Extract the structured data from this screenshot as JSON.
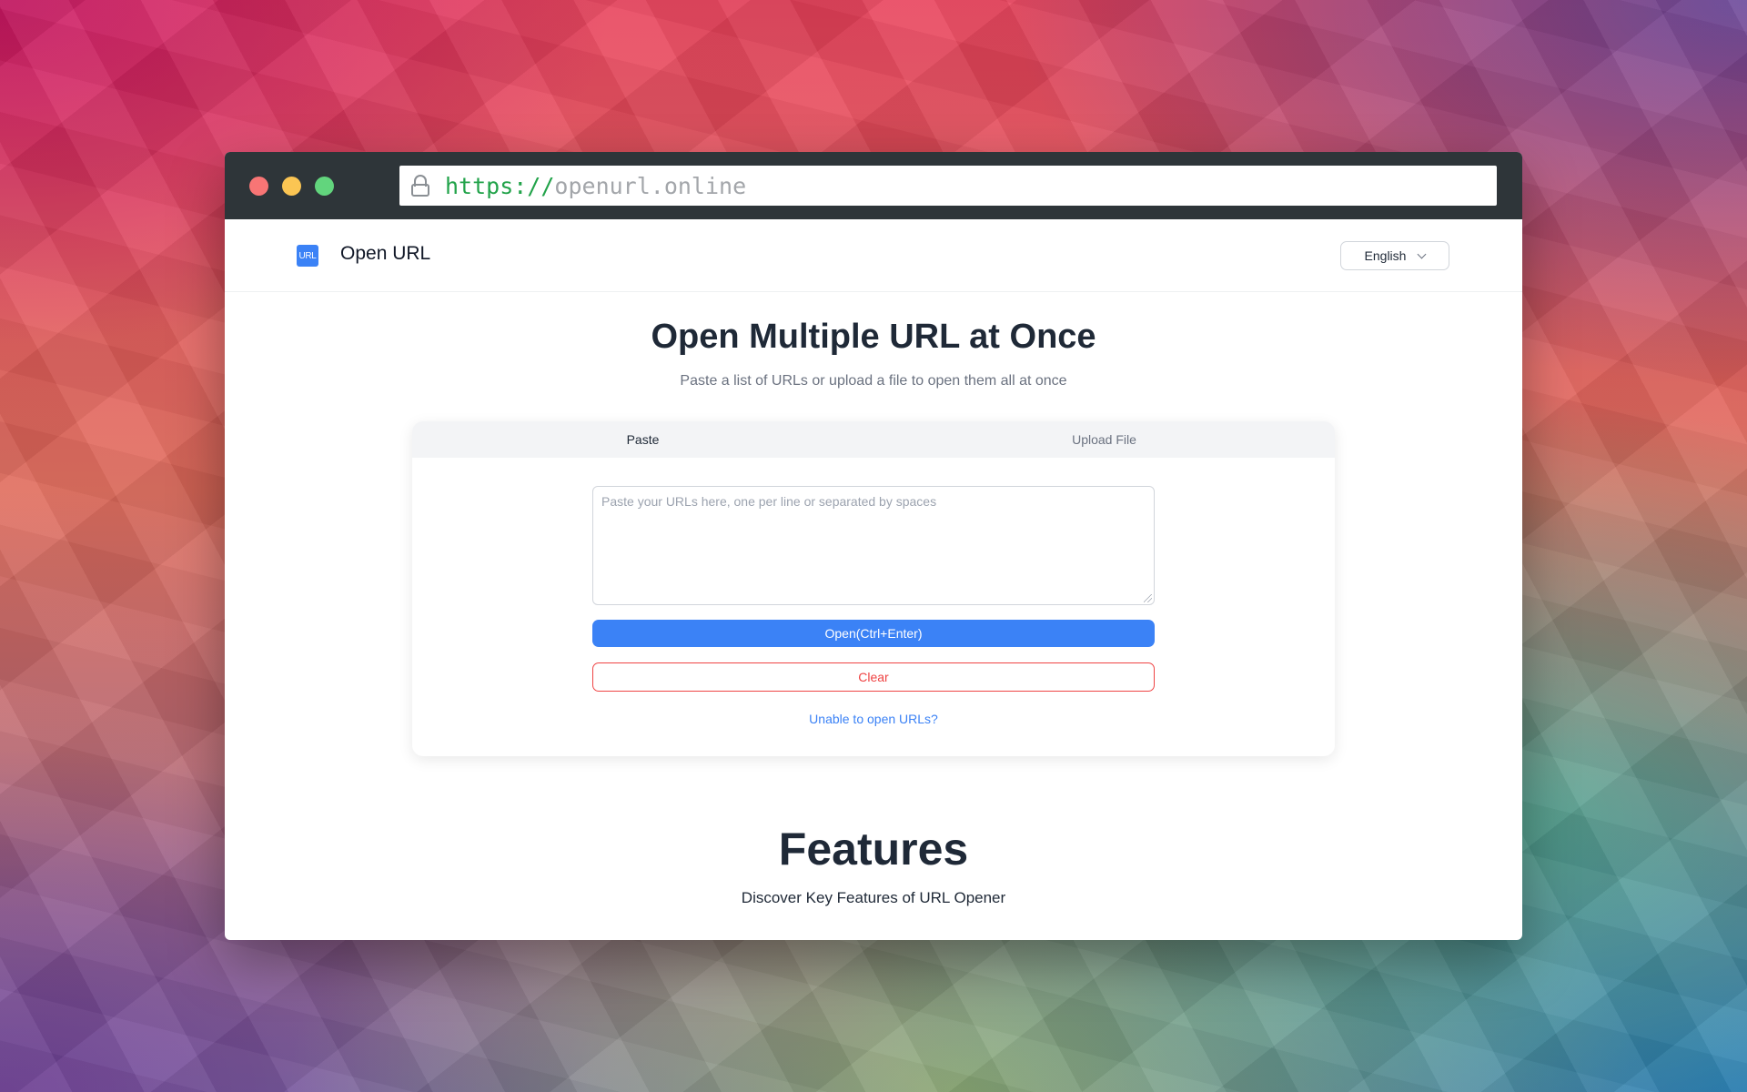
{
  "browser": {
    "url_scheme": "https://",
    "url_host": "openurl.online"
  },
  "header": {
    "logo_text": "URL",
    "site_name": "Open URL",
    "language": "English"
  },
  "hero": {
    "title": "Open Multiple URL at Once",
    "subtitle": "Paste a list of URLs or upload a file to open them all at once"
  },
  "card": {
    "tabs": [
      {
        "label": "Paste",
        "active": true
      },
      {
        "label": "Upload File",
        "active": false
      }
    ],
    "textarea": {
      "value": "",
      "placeholder": "Paste your URLs here, one per line or separated by spaces"
    },
    "open_label": "Open(Ctrl+Enter)",
    "clear_label": "Clear",
    "help_link": "Unable to open URLs?"
  },
  "features": {
    "title": "Features",
    "subtitle": "Discover Key Features of URL Opener"
  },
  "colors": {
    "accent": "#3b82f6",
    "danger": "#ef4444",
    "titlebar": "#2e3539",
    "url_scheme": "#22a34a"
  }
}
